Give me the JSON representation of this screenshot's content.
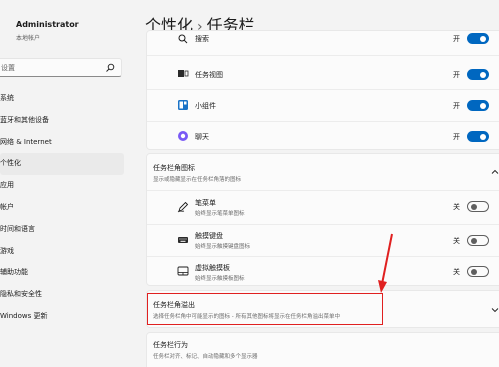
{
  "user": {
    "name": "Administrator",
    "account_type": "本地帐户"
  },
  "search": {
    "placeholder": "设置"
  },
  "sidebar": {
    "items": [
      {
        "label": "系统"
      },
      {
        "label": "蓝牙和其他设备"
      },
      {
        "label": "网络 & Internet"
      },
      {
        "label": "个性化",
        "active": true
      },
      {
        "label": "应用"
      },
      {
        "label": "帐户"
      },
      {
        "label": "时间和语言"
      },
      {
        "label": "游戏"
      },
      {
        "label": "辅助功能"
      },
      {
        "label": "隐私和安全性"
      },
      {
        "label": "Windows 更新"
      }
    ]
  },
  "header": {
    "crumb_parent": "个性化",
    "separator": "›",
    "crumb_current": "任务栏"
  },
  "taskbar_items": {
    "rows": [
      {
        "label": "搜索",
        "state": "开",
        "on": true,
        "icon": "search-icon"
      },
      {
        "label": "任务视图",
        "state": "开",
        "on": true,
        "icon": "task-view-icon"
      },
      {
        "label": "小组件",
        "state": "开",
        "on": true,
        "icon": "widgets-icon"
      },
      {
        "label": "聊天",
        "state": "开",
        "on": true,
        "icon": "chat-icon"
      }
    ]
  },
  "corner_icons": {
    "title": "任务栏角图标",
    "description": "显示或隐藏显示在任务栏角落的图标",
    "rows": [
      {
        "label": "笔菜单",
        "description": "始终显示笔菜单图标",
        "state": "关",
        "on": false,
        "icon": "pen-icon"
      },
      {
        "label": "触摸键盘",
        "description": "始终显示触摸键盘图标",
        "state": "关",
        "on": false,
        "icon": "keyboard-icon"
      },
      {
        "label": "虚拟触摸板",
        "description": "始终显示触摸板图标",
        "state": "关",
        "on": false,
        "icon": "touchpad-icon"
      }
    ]
  },
  "overflow": {
    "title": "任务栏角溢出",
    "description": "选择任务栏角中可能显示的图标 - 所有其他图标将显示在任务栏角溢出菜单中"
  },
  "behaviors": {
    "title": "任务栏行为",
    "description": "任务栏对齐、标记、自动隐藏和多个显示器"
  },
  "colors": {
    "accent": "#0067c0",
    "annotation": "#e02020"
  }
}
